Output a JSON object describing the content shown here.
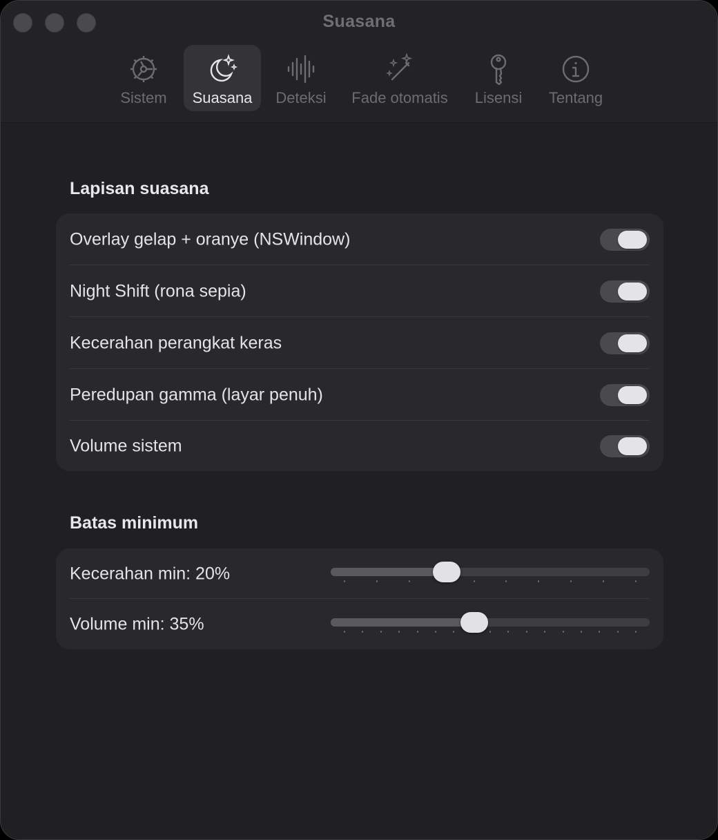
{
  "window": {
    "title": "Suasana"
  },
  "tabs": [
    {
      "label": "Sistem",
      "icon": "gear-icon",
      "selected": false
    },
    {
      "label": "Suasana",
      "icon": "moon-stars-icon",
      "selected": true
    },
    {
      "label": "Deteksi",
      "icon": "waveform-icon",
      "selected": false
    },
    {
      "label": "Fade otomatis",
      "icon": "magic-wand-icon",
      "selected": false
    },
    {
      "label": "Lisensi",
      "icon": "key-icon",
      "selected": false
    },
    {
      "label": "Tentang",
      "icon": "info-circle-icon",
      "selected": false
    }
  ],
  "layers": {
    "title": "Lapisan suasana",
    "items": [
      {
        "label": "Overlay gelap + oranye (NSWindow)",
        "on": true
      },
      {
        "label": "Night Shift (rona sepia)",
        "on": true
      },
      {
        "label": "Kecerahan perangkat keras",
        "on": true
      },
      {
        "label": "Peredupan gamma (layar penuh)",
        "on": true
      },
      {
        "label": "Volume sistem",
        "on": true
      }
    ]
  },
  "minimums": {
    "title": "Batas minimum",
    "items": [
      {
        "label": "Kecerahan min: 20%",
        "value": 0.35,
        "ticks": 10
      },
      {
        "label": "Volume min: 35%",
        "value": 0.445,
        "ticks": 17
      }
    ]
  },
  "colors": {
    "background": "#202022",
    "card": "#29292b",
    "selected_tab": "#343437",
    "text": "#e4e4e6",
    "muted_text": "#6d6d70"
  }
}
